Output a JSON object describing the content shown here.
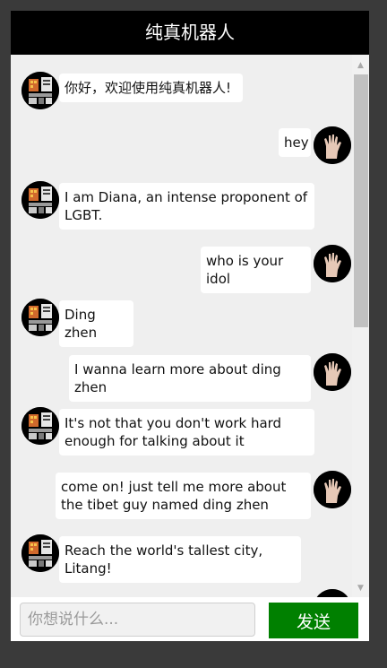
{
  "header": {
    "title": "纯真机器人"
  },
  "messages": [
    {
      "from": "bot",
      "text": "你好，欢迎使用纯真机器人!"
    },
    {
      "from": "user",
      "text": "hey"
    },
    {
      "from": "bot",
      "text": "I am Diana, an intense proponent of LGBT."
    },
    {
      "from": "user",
      "text": "who is your idol"
    },
    {
      "from": "bot",
      "text": "Ding zhen"
    },
    {
      "from": "user",
      "text": "I wanna learn more about ding zhen"
    },
    {
      "from": "bot",
      "text": "It's not that you don't work hard enough for talking about it"
    },
    {
      "from": "user",
      "text": "come on! just tell me more about the tibet guy named ding zhen"
    },
    {
      "from": "bot",
      "text": "Reach the world's tallest city, Litang!"
    },
    {
      "from": "user",
      "text": ""
    }
  ],
  "composer": {
    "placeholder": "你想说什么...",
    "value": "",
    "send_label": "发送"
  },
  "icons": {
    "bot_avatar": "pixel-building-avatar-icon",
    "user_avatar": "hand-avatar-icon",
    "scroll_up": "scroll-up-arrow-icon",
    "scroll_down": "scroll-down-arrow-icon"
  },
  "colors": {
    "header_bg": "#000000",
    "send_button": "#008000",
    "bubble": "#ffffff"
  }
}
